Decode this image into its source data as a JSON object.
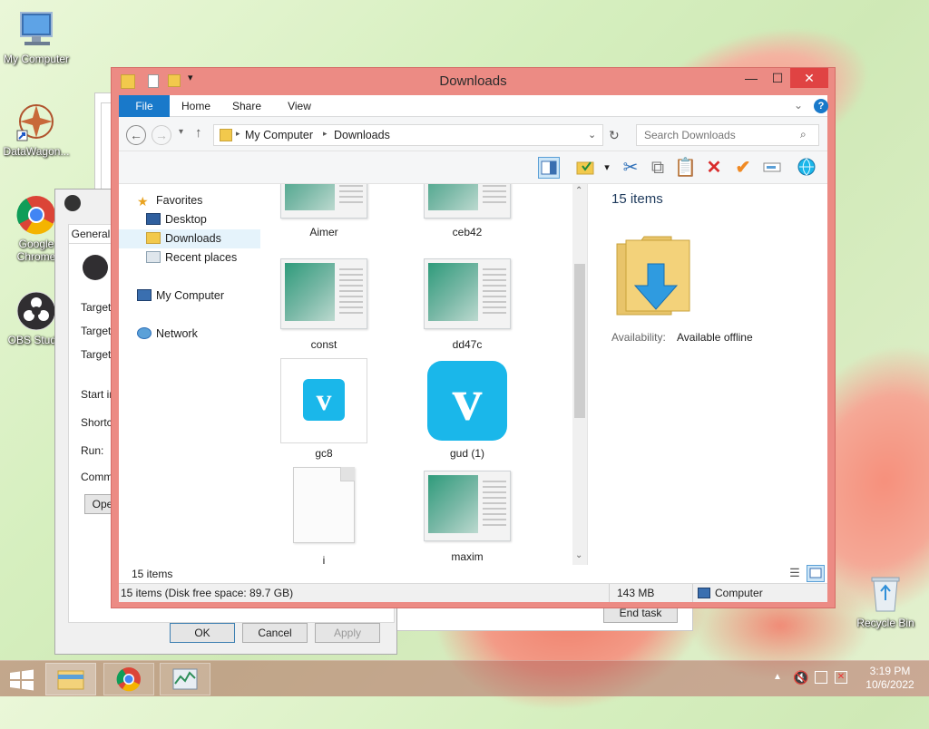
{
  "desktop": {
    "icons": [
      {
        "label": "My Computer",
        "icon": "computer-icon"
      },
      {
        "label": "DataWagon...",
        "icon": "datawagon-shortcut-icon"
      },
      {
        "label": "Google Chrome",
        "icon": "chrome-icon"
      },
      {
        "label": "OBS Studio",
        "icon": "obs-icon"
      },
      {
        "label": "Recycle Bin",
        "icon": "recycle-bin-icon"
      }
    ]
  },
  "background_windows": {
    "properties": {
      "tabs": [
        "General"
      ],
      "fields": [
        "Target",
        "Target",
        "Target:",
        "Start in",
        "Shortcu",
        "Run:",
        "Comme"
      ],
      "open_button": "Ope",
      "ok": "OK",
      "cancel": "Cancel",
      "apply": "Apply"
    },
    "task_manager": {
      "end_task": "End task"
    }
  },
  "explorer": {
    "title": "Downloads",
    "window_controls": {
      "minimize": "—",
      "maximize": "☐",
      "close": "✕"
    },
    "ribbon_tabs": [
      "File",
      "Home",
      "Share",
      "View"
    ],
    "address": {
      "path": [
        "My Computer",
        "Downloads"
      ]
    },
    "search": {
      "placeholder": "Search Downloads"
    },
    "nav": {
      "favorites": "Favorites",
      "desktop": "Desktop",
      "downloads": "Downloads",
      "recent": "Recent places",
      "computer": "My Computer",
      "network": "Network"
    },
    "files": [
      {
        "name": "Aimer",
        "type": "image"
      },
      {
        "name": "ceb42",
        "type": "image"
      },
      {
        "name": "const",
        "type": "image"
      },
      {
        "name": "dd47c",
        "type": "image"
      },
      {
        "name": "gc8",
        "type": "vimeo"
      },
      {
        "name": "gud (1)",
        "type": "vimeo-large"
      },
      {
        "name": "i",
        "type": "blank"
      },
      {
        "name": "maxim",
        "type": "image"
      }
    ],
    "preview": {
      "count": "15 items",
      "availability_label": "Availability:",
      "availability_value": "Available offline"
    },
    "status": {
      "items": "15 items"
    },
    "bottom": {
      "disk": "15 items (Disk free space: 89.7 GB)",
      "size": "143 MB",
      "location": "Computer"
    }
  },
  "taskbar": {
    "time": "3:19 PM",
    "date": "10/6/2022",
    "apps": [
      "file-explorer-icon",
      "chrome-icon",
      "task-manager-icon"
    ]
  },
  "colors": {
    "accent": "#1979ca",
    "window_frame": "#ec8b84",
    "vimeo": "#1ab7ea"
  }
}
